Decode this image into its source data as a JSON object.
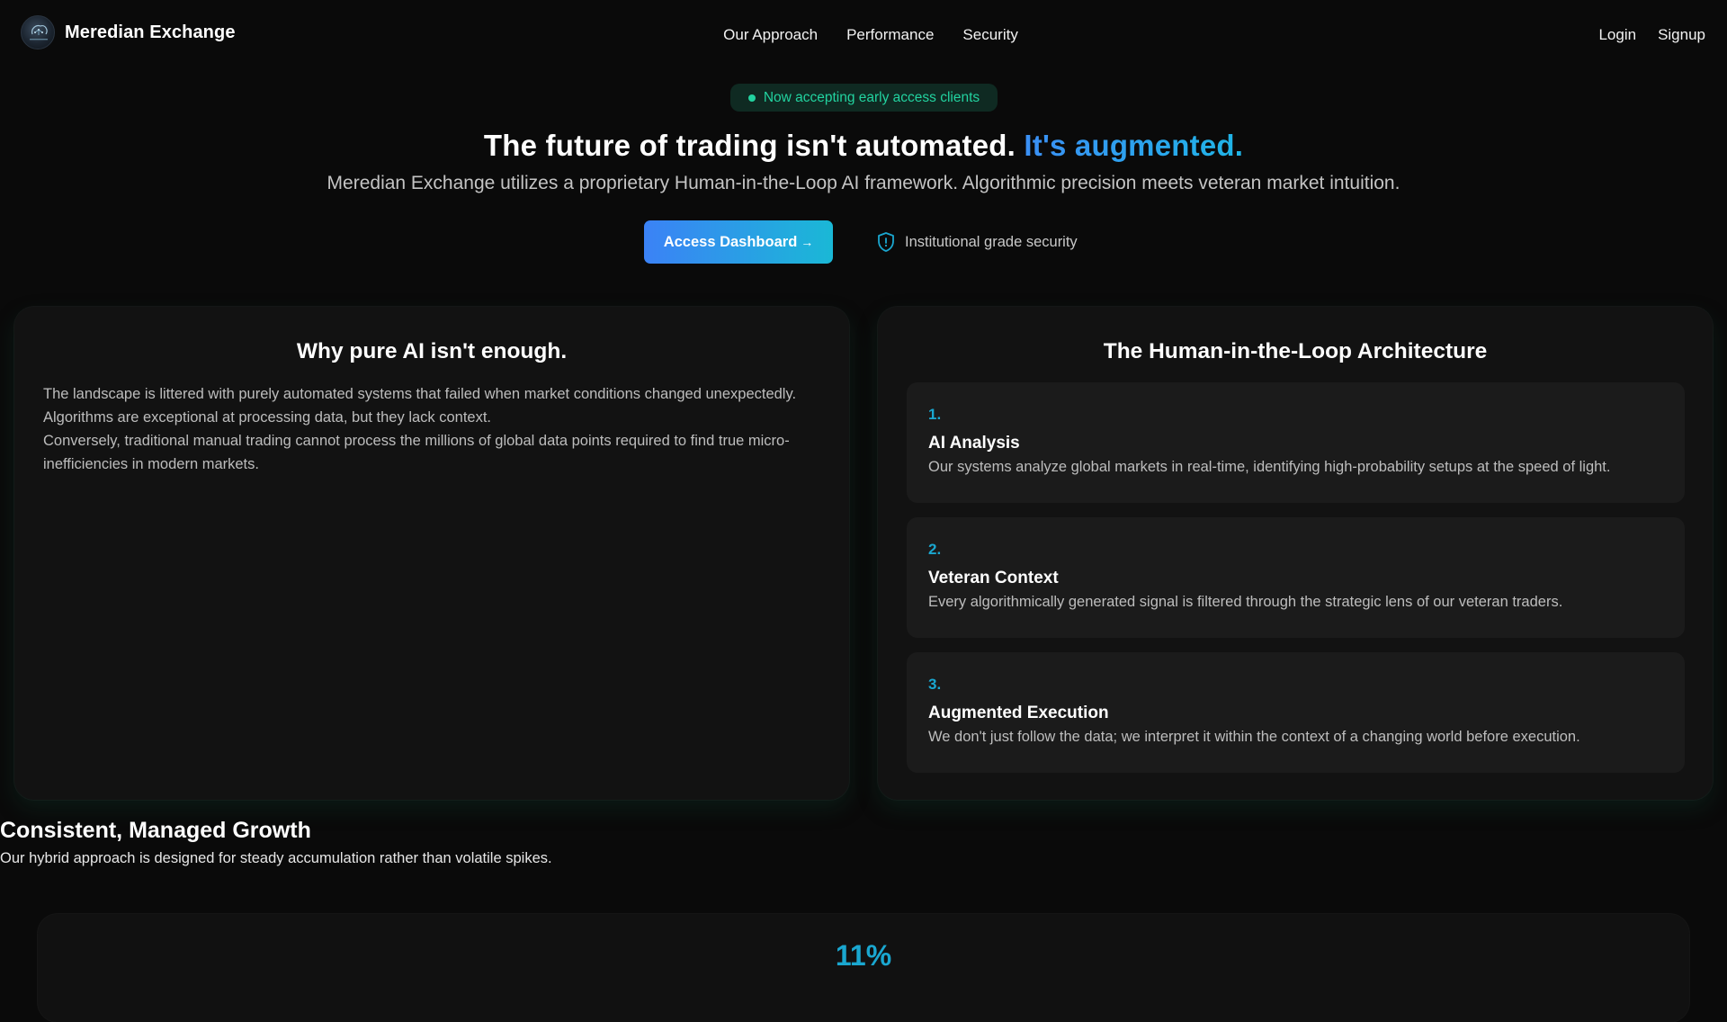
{
  "brand": {
    "name": "Meredian Exchange",
    "logo_icon": "brain-circuit-icon"
  },
  "nav": {
    "links": [
      "Our Approach",
      "Performance",
      "Security"
    ],
    "login": "Login",
    "signup": "Signup"
  },
  "hero": {
    "badge": "Now accepting early access clients",
    "headline_main": "The future of trading isn't automated.",
    "headline_accent": "It's augmented.",
    "subheadline": "Meredian Exchange utilizes a proprietary Human-in-the-Loop AI framework. Algorithmic precision meets veteran market intuition.",
    "cta_label": "Access Dashboard",
    "cta_arrow": "→",
    "security_icon": "shield-icon",
    "security_label": "Institutional grade security"
  },
  "why_card": {
    "title": "Why pure AI isn't enough.",
    "paragraph_1": "The landscape is littered with purely automated systems that failed when market conditions changed unexpectedly. Algorithms are exceptional at processing data, but they lack context.",
    "paragraph_2": "Conversely, traditional manual trading cannot process the millions of global data points required to find true micro-inefficiencies in modern markets."
  },
  "architecture_card": {
    "title": "The Human-in-the-Loop Architecture",
    "steps": [
      {
        "number": "1.",
        "title": "AI Analysis",
        "description": "Our systems analyze global markets in real-time, identifying high-probability setups at the speed of light."
      },
      {
        "number": "2.",
        "title": "Veteran Context",
        "description": "Every algorithmically generated signal is filtered through the strategic lens of our veteran traders."
      },
      {
        "number": "3.",
        "title": "Augmented Execution",
        "description": "We don't just follow the data; we interpret it within the context of a changing world before execution."
      }
    ]
  },
  "growth": {
    "title": "Consistent, Managed Growth",
    "subtitle": "Our hybrid approach is designed for steady accumulation rather than volatile spikes.",
    "stat_value": "11%"
  },
  "colors": {
    "background": "#0a0a0a",
    "card": "#121212",
    "accent_blue": "#3b82f6",
    "accent_cyan": "#1aa7d0",
    "badge_green": "#22d3a0"
  }
}
